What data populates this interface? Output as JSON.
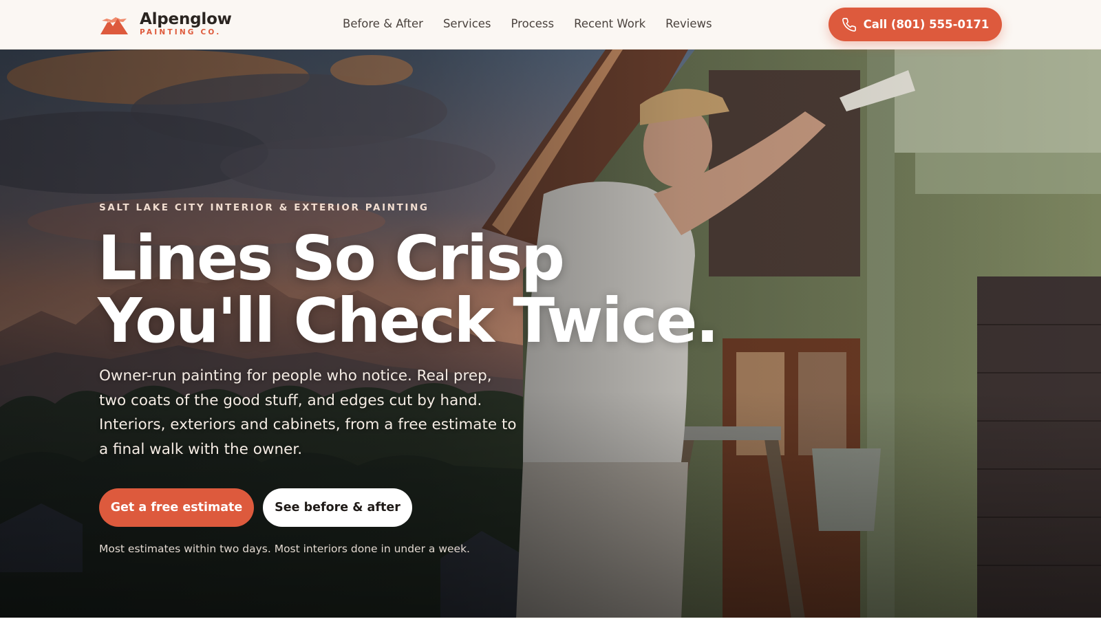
{
  "brand": {
    "name": "Alpenglow",
    "tagline": "PAINTING CO.",
    "accent_color": "#dd5a3d",
    "logo_icon": "mountain-icon"
  },
  "nav": {
    "links": [
      {
        "label": "Before & After"
      },
      {
        "label": "Services"
      },
      {
        "label": "Process"
      },
      {
        "label": "Recent Work"
      },
      {
        "label": "Reviews"
      }
    ]
  },
  "header": {
    "call_label": "Call (801) 555-0171",
    "call_icon": "phone-icon"
  },
  "hero": {
    "eyebrow": "SALT LAKE CITY INTERIOR & EXTERIOR PAINTING",
    "headline_line1": "Lines So Crisp",
    "headline_line2": "You'll Check Twice.",
    "intro": "Owner-run painting for people who notice. Real prep, two coats of the good stuff, and edges cut by hand. Interiors, exteriors and cabinets, from a free estimate to a final walk with the owner.",
    "primary_cta": "Get a free estimate",
    "secondary_cta": "See before & after",
    "footnote": "Most estimates within two days. Most interiors done in under a week."
  }
}
